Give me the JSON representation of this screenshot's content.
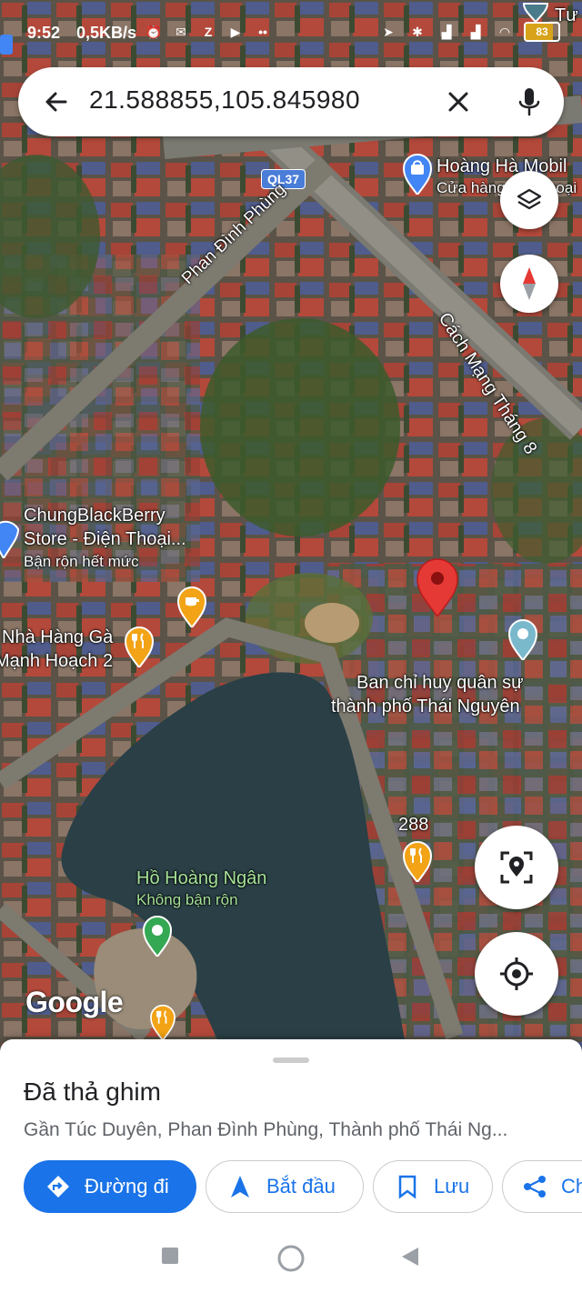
{
  "status_bar": {
    "time": "9:52",
    "network_speed": "0,5KB/s",
    "battery": "83",
    "icons_left": [
      "alarm-icon",
      "messenger-icon",
      "zalo-icon",
      "youtube-icon",
      "more-dots-icon"
    ],
    "icons_right": [
      "location-arrow-icon",
      "bluetooth-icon",
      "signal-icon",
      "signal-icon",
      "wifi-icon"
    ]
  },
  "search": {
    "query": "21.588855,105.845980"
  },
  "map": {
    "road_shield": "QL37",
    "roads": [
      "Phan Đình Phùng",
      "Cách Mạng Tháng 8"
    ],
    "places": [
      {
        "name": "Hoàng Hà Mobil",
        "sub": "Cửa hàng điện thoại"
      },
      {
        "name": "ChungBlackBerry",
        "name2": "Store - Điện Thoại...",
        "sub": "Bận rộn hết mức"
      },
      {
        "name": "Nhà Hàng Gà",
        "name2": "Mạnh Hoạch 2"
      },
      {
        "name": "Ban chỉ huy quân sự",
        "name2": "thành phố Thái Nguyên"
      },
      {
        "name": "288"
      },
      {
        "name": "Hồ Hoàng Ngân",
        "sub": "Không bận rộn"
      }
    ],
    "corner_label": "Tư",
    "logo": "Google"
  },
  "sheet": {
    "title": "Đã thả ghim",
    "address": "Gần Túc Duyên, Phan Đình Phùng, Thành phố Thái Ng...",
    "actions": [
      {
        "label": "Đường đi",
        "icon": "directions-icon"
      },
      {
        "label": "Bắt đầu",
        "icon": "navigation-arrow-icon"
      },
      {
        "label": "Lưu",
        "icon": "bookmark-icon"
      },
      {
        "label": "Ch",
        "icon": "share-icon"
      }
    ]
  },
  "colors": {
    "accent": "#1a73e8",
    "pin_red": "#e53935",
    "poi_orange": "#f2a316",
    "poi_blue": "#4285f4",
    "poi_green": "#34a853",
    "water": "#2a3f46"
  }
}
